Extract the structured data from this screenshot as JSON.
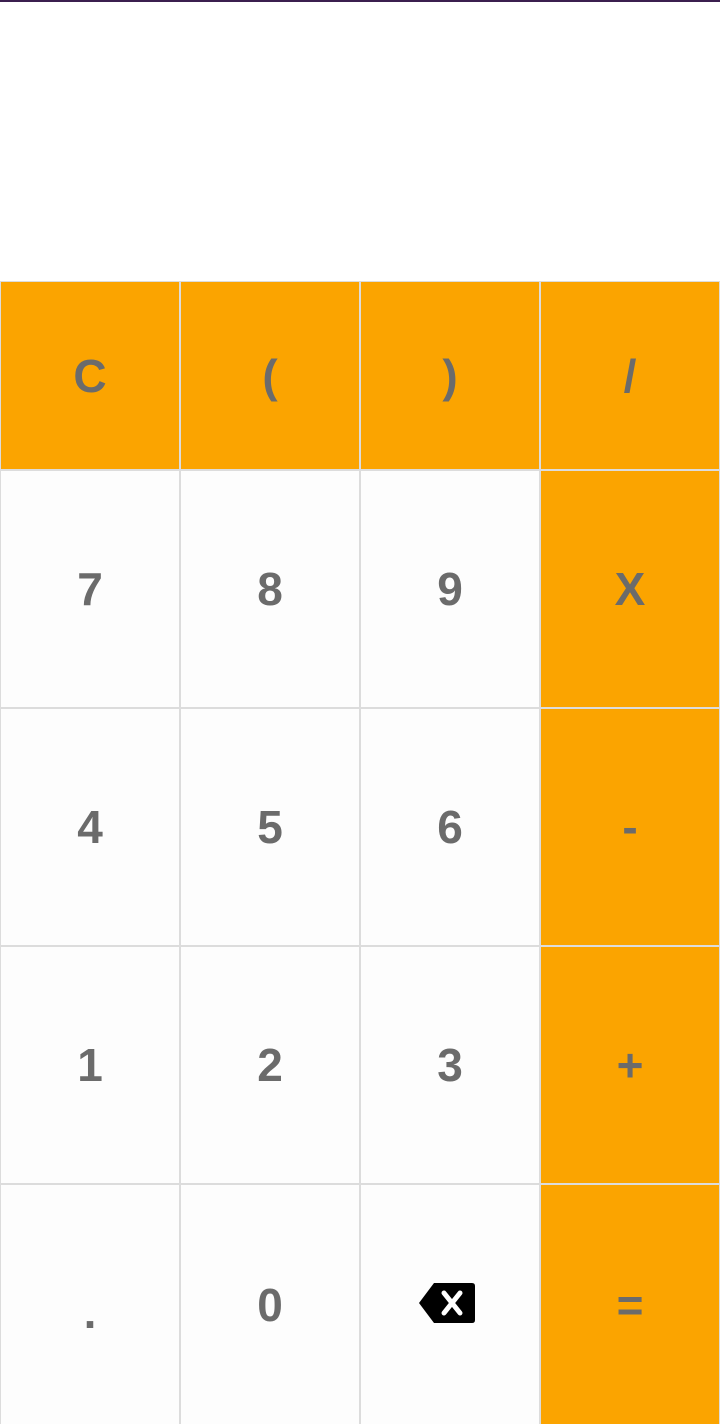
{
  "display": {
    "expression": ""
  },
  "keys": {
    "clear": "C",
    "open_paren": "(",
    "close_paren": ")",
    "divide": "/",
    "seven": "7",
    "eight": "8",
    "nine": "9",
    "multiply": "X",
    "four": "4",
    "five": "5",
    "six": "6",
    "minus": "-",
    "one": "1",
    "two": "2",
    "three": "3",
    "plus": "+",
    "dot": ".",
    "zero": "0",
    "backspace_icon": "backspace-icon",
    "equals": "="
  },
  "colors": {
    "operator": "#fba400",
    "digit": "#fdfdfd",
    "key_text": "#6b6b6b",
    "grid_line": "#dcdcdc"
  }
}
